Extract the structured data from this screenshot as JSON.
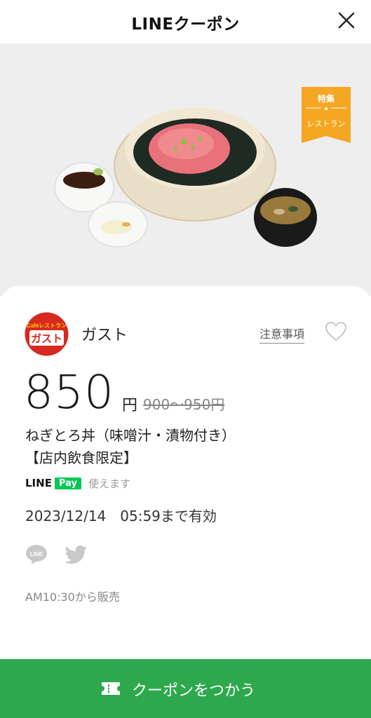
{
  "header": {
    "title": "LINEクーポン"
  },
  "badge": {
    "top": "特集",
    "bottom": "レストラン"
  },
  "shop": {
    "logo_top": "Caféレストラン",
    "logo_main": "ガスト",
    "name": "ガスト",
    "notes_label": "注意事項"
  },
  "offer": {
    "price": "850",
    "unit": "円",
    "original_price": "900〜950円",
    "title_line1": "ねぎとろ丼（味噌汁・漬物付き）",
    "title_line2": "【店内飲食限定】",
    "pay_line": "LINE",
    "pay_pay": "Pay",
    "pay_usable": "使えます",
    "valid_until": "2023/12/14　05:59まで有効",
    "sale_time": "AM10:30から販売"
  },
  "share": {
    "line_label": "LINE"
  },
  "action": {
    "button_label": "クーポンをつかう"
  },
  "colors": {
    "accent": "#2ea84d",
    "badge": "#f5a623",
    "brand_red": "#d6291f",
    "line_green": "#06c755"
  }
}
